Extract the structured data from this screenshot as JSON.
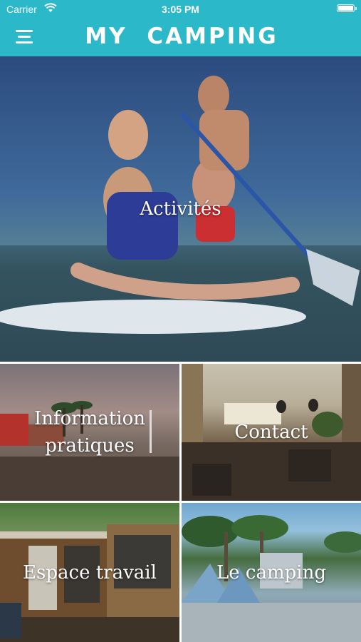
{
  "status_bar": {
    "carrier": "Carrier",
    "time": "3:05 PM"
  },
  "header": {
    "title": "MY CAMPING",
    "background": "#2bb8c9"
  },
  "tiles": [
    {
      "label": "Activités"
    },
    {
      "label_line1": "Information",
      "label_line2": "pratiques"
    },
    {
      "label": "Contact"
    },
    {
      "label": "Espace travail"
    },
    {
      "label": "Le camping"
    }
  ]
}
